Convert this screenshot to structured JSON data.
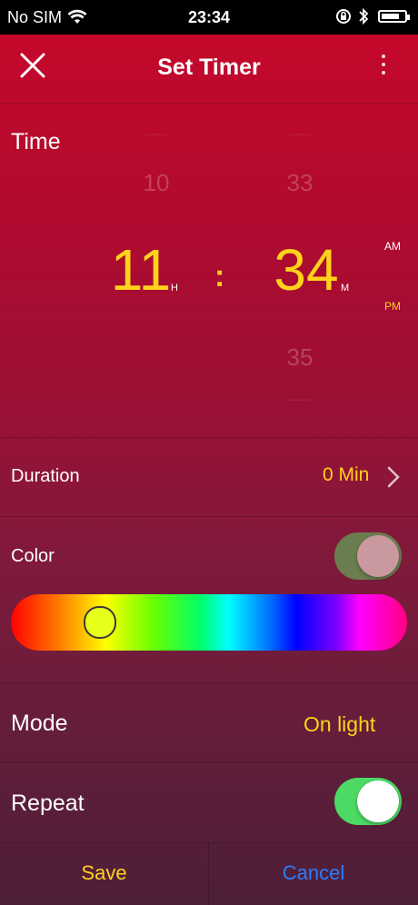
{
  "status_bar": {
    "carrier": "No SIM",
    "time": "23:34",
    "battery_level": 0.8
  },
  "nav": {
    "title": "Set Timer"
  },
  "time_picker": {
    "label": "Time",
    "hour_prev": "10",
    "hour": "11",
    "hour_unit": "H",
    "separator": ":",
    "minute_prev": "33",
    "minute": "34",
    "minute_unit": "M",
    "minute_next": "35",
    "am": "AM",
    "pm": "PM",
    "selected_period": "PM"
  },
  "duration": {
    "label": "Duration",
    "value": "0 Min"
  },
  "color": {
    "label": "Color",
    "enabled": true,
    "selected_hue_position": 0.22,
    "selected_color": "#e8ff1a"
  },
  "mode": {
    "label": "Mode",
    "value": "On light"
  },
  "repeat": {
    "label": "Repeat",
    "enabled": true
  },
  "footer": {
    "save_label": "Save",
    "cancel_label": "Cancel"
  },
  "colors": {
    "accent": "#ffd21c",
    "cancel": "#2a7dff",
    "toggle_on": "#4cd964",
    "color_toggle": "#6b7e4f"
  }
}
